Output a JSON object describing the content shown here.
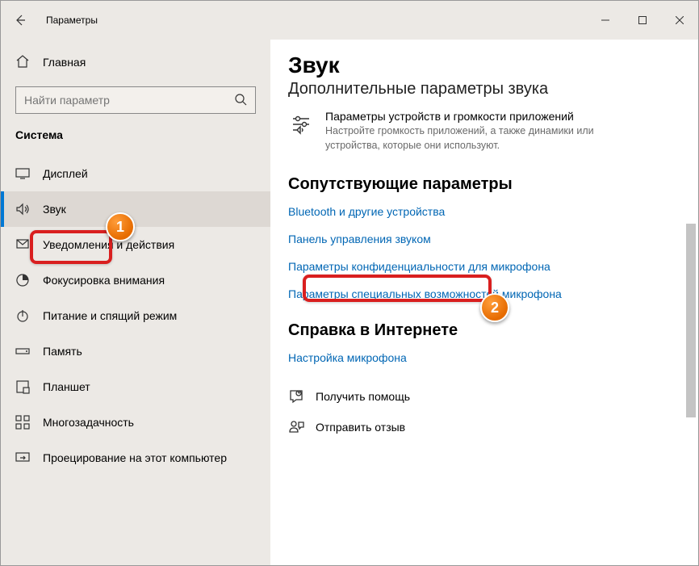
{
  "titlebar": {
    "title": "Параметры"
  },
  "sidebar": {
    "home_label": "Главная",
    "search_placeholder": "Найти параметр",
    "category": "Система",
    "items": [
      {
        "label": "Дисплей"
      },
      {
        "label": "Звук"
      },
      {
        "label": "Уведомления и действия"
      },
      {
        "label": "Фокусировка внимания"
      },
      {
        "label": "Питание и спящий режим"
      },
      {
        "label": "Память"
      },
      {
        "label": "Планшет"
      },
      {
        "label": "Многозадачность"
      },
      {
        "label": "Проецирование на этот компьютер"
      }
    ]
  },
  "content": {
    "page_title": "Звук",
    "advanced_title": "Дополнительные параметры звука",
    "app_volume": {
      "title": "Параметры устройств и громкости приложений",
      "desc": "Настройте громкость приложений, а также динамики или устройства, которые они используют."
    },
    "related_title": "Сопутствующие параметры",
    "related_links": [
      "Bluetooth и другие устройства",
      "Панель управления звуком",
      "Параметры конфиденциальности для микрофона",
      "Параметры специальных возможностей микрофона"
    ],
    "help_title": "Справка в Интернете",
    "help_links": [
      "Настройка микрофона"
    ],
    "footer": {
      "get_help": "Получить помощь",
      "feedback": "Отправить отзыв"
    }
  },
  "annotations": {
    "badge1": "1",
    "badge2": "2"
  }
}
